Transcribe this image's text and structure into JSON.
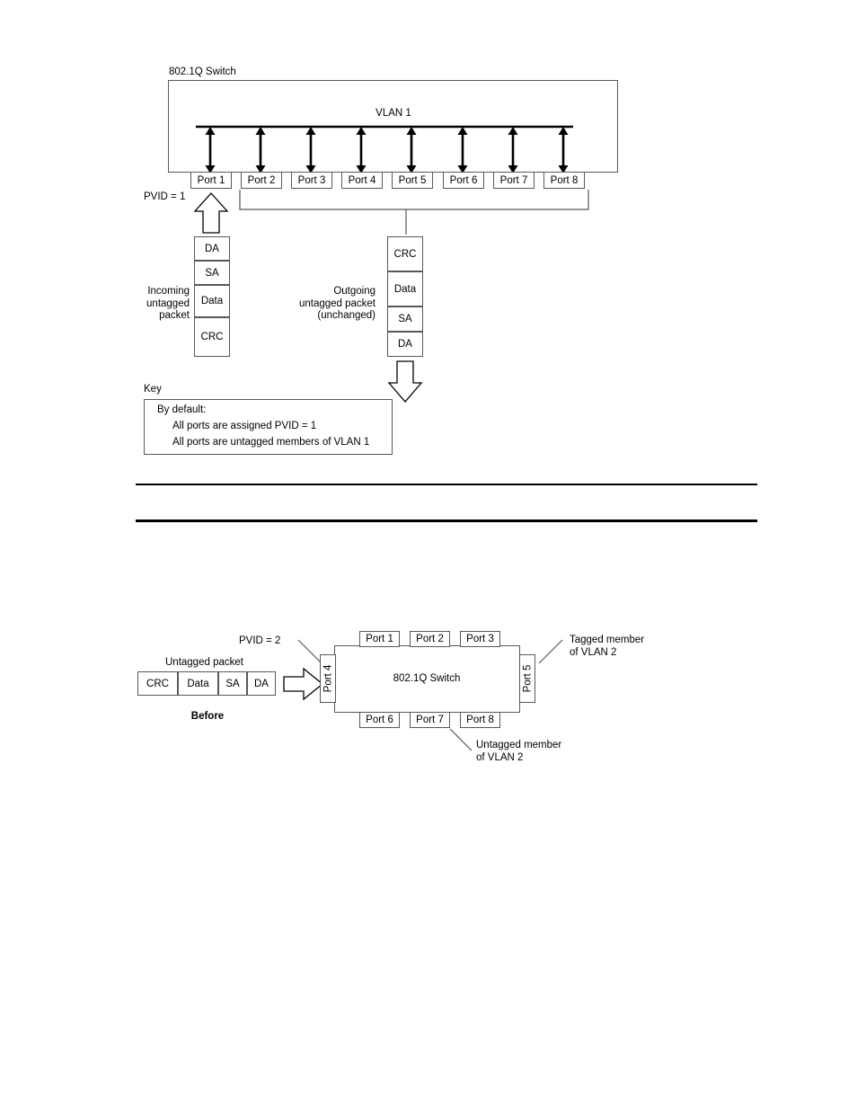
{
  "figure1": {
    "switch_label": "802.1Q Switch",
    "vlan_label": "VLAN 1",
    "pvid_label": "PVID = 1",
    "ports": [
      "Port 1",
      "Port 2",
      "Port 3",
      "Port 4",
      "Port 5",
      "Port 6",
      "Port 7",
      "Port 8"
    ],
    "incoming_caption": "Incoming\nuntagged\npacket",
    "incoming_packet": [
      "DA",
      "SA",
      "Data",
      "CRC"
    ],
    "outgoing_caption": "Outgoing\nuntagged packet\n(unchanged)",
    "outgoing_packet": [
      "CRC",
      "Data",
      "SA",
      "DA"
    ],
    "key_title": "Key",
    "key_lines": [
      "By default:",
      "All ports are assigned PVID = 1",
      "All ports are untagged members of VLAN 1"
    ]
  },
  "figure2": {
    "switch_label": "802.1Q Switch",
    "pvid_label": "PVID = 2",
    "packet_caption": "Untagged packet",
    "packet_cells": [
      "CRC",
      "Data",
      "SA",
      "DA"
    ],
    "state_label": "Before",
    "ports_top": [
      "Port 1",
      "Port 2",
      "Port 3"
    ],
    "ports_bottom": [
      "Port 6",
      "Port 7",
      "Port 8"
    ],
    "port_left": "Port 4",
    "port_right": "Port 5",
    "callout_tagged": "Tagged member\nof VLAN 2",
    "callout_untagged": "Untagged member\nof VLAN 2"
  }
}
